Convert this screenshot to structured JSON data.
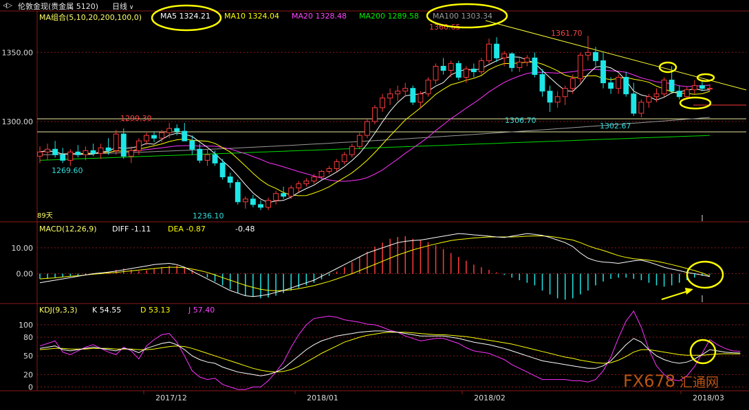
{
  "header": {
    "back_glyph": "◃▷",
    "instrument": "伦敦金现(贵金属 5120)",
    "period": "日线"
  },
  "colors": {
    "up": "#ff3b3b",
    "down": "#1ee6e6",
    "ma5": "#ffffff",
    "ma10": "#ffff00",
    "ma20": "#ff33ff",
    "ma200": "#00dd00",
    "ma100": "#9a9a9a",
    "diff": "#ffffff",
    "dea": "#ffff00",
    "k": "#ffffff",
    "d": "#ffff00",
    "j": "#ff33ff",
    "annotation": "#ffff00",
    "grid": "#8b1a1a"
  },
  "price_panel": {
    "legend": {
      "title": "MA组合(5,10,20,200,100,0)",
      "ma5": "MA5 1324.21",
      "ma10": "MA10 1324.04",
      "ma20": "MA20 1328.48",
      "ma200": "MA200 1289.58",
      "ma100": "MA100 1303.34"
    },
    "y_ticks": [
      "1350.00",
      "1300.00"
    ],
    "ylim": [
      1228,
      1372
    ],
    "days_label": "89天",
    "annotations": [
      {
        "text": "1299.30",
        "color": "#ff4444"
      },
      {
        "text": "1269.60",
        "color": "#33dddd"
      },
      {
        "text": "1236.10",
        "color": "#33dddd"
      },
      {
        "text": "1360.65",
        "color": "#ff4444"
      },
      {
        "text": "1361.70",
        "color": "#ff4444"
      },
      {
        "text": "1306.70",
        "color": "#33dddd"
      },
      {
        "text": "1302.67",
        "color": "#33dddd"
      }
    ]
  },
  "macd_panel": {
    "legend": {
      "title": "MACD(12,26,9)",
      "diff": "DIFF  -1.11",
      "dea": "DEA  -0.87",
      "macd": "-0.48"
    },
    "y_ticks": [
      "10.00",
      "0.00"
    ],
    "ylim": [
      -11,
      15
    ]
  },
  "kdj_panel": {
    "legend": {
      "title": "KDJ(9,3,3)",
      "k": "K  54.55",
      "d": "D  53.13",
      "j": "J  57.40"
    },
    "y_ticks": [
      "100",
      "80",
      "50",
      "20",
      "0"
    ],
    "ylim": [
      -5,
      112
    ]
  },
  "x_axis": {
    "labels": [
      "2017/12",
      "2018/01",
      "2018/02",
      "2018/03"
    ]
  },
  "watermark": {
    "text": "FX678",
    "text2": "汇通网"
  },
  "chart_data": {
    "type": "candlestick",
    "series_count": 89,
    "candles": [
      {
        "o": 1275,
        "h": 1282,
        "l": 1270,
        "c": 1278
      },
      {
        "o": 1278,
        "h": 1284,
        "l": 1272,
        "c": 1280
      },
      {
        "o": 1280,
        "h": 1286,
        "l": 1274,
        "c": 1276
      },
      {
        "o": 1276,
        "h": 1281,
        "l": 1270,
        "c": 1272
      },
      {
        "o": 1272,
        "h": 1280,
        "l": 1268,
        "c": 1278
      },
      {
        "o": 1278,
        "h": 1283,
        "l": 1274,
        "c": 1276
      },
      {
        "o": 1276,
        "h": 1282,
        "l": 1272,
        "c": 1279
      },
      {
        "o": 1279,
        "h": 1284,
        "l": 1275,
        "c": 1277
      },
      {
        "o": 1277,
        "h": 1284,
        "l": 1273,
        "c": 1281
      },
      {
        "o": 1281,
        "h": 1288,
        "l": 1276,
        "c": 1279
      },
      {
        "o": 1279,
        "h": 1294,
        "l": 1276,
        "c": 1291
      },
      {
        "o": 1291,
        "h": 1295,
        "l": 1273,
        "c": 1275
      },
      {
        "o": 1275,
        "h": 1282,
        "l": 1270,
        "c": 1279
      },
      {
        "o": 1279,
        "h": 1288,
        "l": 1276,
        "c": 1286
      },
      {
        "o": 1286,
        "h": 1292,
        "l": 1283,
        "c": 1290
      },
      {
        "o": 1290,
        "h": 1293,
        "l": 1285,
        "c": 1288
      },
      {
        "o": 1288,
        "h": 1294,
        "l": 1285,
        "c": 1292
      },
      {
        "o": 1292,
        "h": 1299,
        "l": 1288,
        "c": 1295
      },
      {
        "o": 1295,
        "h": 1298,
        "l": 1290,
        "c": 1293
      },
      {
        "o": 1293,
        "h": 1299,
        "l": 1286,
        "c": 1286
      },
      {
        "o": 1286,
        "h": 1290,
        "l": 1276,
        "c": 1280
      },
      {
        "o": 1280,
        "h": 1284,
        "l": 1270,
        "c": 1272
      },
      {
        "o": 1272,
        "h": 1280,
        "l": 1268,
        "c": 1276
      },
      {
        "o": 1276,
        "h": 1279,
        "l": 1268,
        "c": 1270
      },
      {
        "o": 1270,
        "h": 1273,
        "l": 1258,
        "c": 1260
      },
      {
        "o": 1260,
        "h": 1263,
        "l": 1252,
        "c": 1256
      },
      {
        "o": 1256,
        "h": 1258,
        "l": 1240,
        "c": 1242
      },
      {
        "o": 1242,
        "h": 1246,
        "l": 1237,
        "c": 1244
      },
      {
        "o": 1244,
        "h": 1247,
        "l": 1238,
        "c": 1240
      },
      {
        "o": 1240,
        "h": 1243,
        "l": 1236,
        "c": 1238
      },
      {
        "o": 1238,
        "h": 1245,
        "l": 1236,
        "c": 1243
      },
      {
        "o": 1243,
        "h": 1250,
        "l": 1240,
        "c": 1248
      },
      {
        "o": 1248,
        "h": 1253,
        "l": 1244,
        "c": 1246
      },
      {
        "o": 1246,
        "h": 1254,
        "l": 1244,
        "c": 1252
      },
      {
        "o": 1252,
        "h": 1257,
        "l": 1249,
        "c": 1255
      },
      {
        "o": 1255,
        "h": 1259,
        "l": 1253,
        "c": 1257
      },
      {
        "o": 1257,
        "h": 1262,
        "l": 1255,
        "c": 1260
      },
      {
        "o": 1260,
        "h": 1265,
        "l": 1258,
        "c": 1264
      },
      {
        "o": 1264,
        "h": 1268,
        "l": 1262,
        "c": 1266
      },
      {
        "o": 1266,
        "h": 1273,
        "l": 1264,
        "c": 1271
      },
      {
        "o": 1271,
        "h": 1278,
        "l": 1269,
        "c": 1276
      },
      {
        "o": 1276,
        "h": 1284,
        "l": 1274,
        "c": 1282
      },
      {
        "o": 1282,
        "h": 1292,
        "l": 1280,
        "c": 1290
      },
      {
        "o": 1290,
        "h": 1302,
        "l": 1288,
        "c": 1300
      },
      {
        "o": 1300,
        "h": 1312,
        "l": 1298,
        "c": 1310
      },
      {
        "o": 1310,
        "h": 1320,
        "l": 1307,
        "c": 1317
      },
      {
        "o": 1317,
        "h": 1324,
        "l": 1312,
        "c": 1320
      },
      {
        "o": 1320,
        "h": 1326,
        "l": 1315,
        "c": 1322
      },
      {
        "o": 1322,
        "h": 1328,
        "l": 1318,
        "c": 1324
      },
      {
        "o": 1324,
        "h": 1326,
        "l": 1312,
        "c": 1314
      },
      {
        "o": 1314,
        "h": 1322,
        "l": 1310,
        "c": 1320
      },
      {
        "o": 1320,
        "h": 1332,
        "l": 1318,
        "c": 1330
      },
      {
        "o": 1330,
        "h": 1342,
        "l": 1327,
        "c": 1340
      },
      {
        "o": 1340,
        "h": 1346,
        "l": 1334,
        "c": 1337
      },
      {
        "o": 1337,
        "h": 1344,
        "l": 1332,
        "c": 1342
      },
      {
        "o": 1342,
        "h": 1344,
        "l": 1330,
        "c": 1332
      },
      {
        "o": 1332,
        "h": 1340,
        "l": 1328,
        "c": 1338
      },
      {
        "o": 1338,
        "h": 1342,
        "l": 1332,
        "c": 1336
      },
      {
        "o": 1336,
        "h": 1346,
        "l": 1334,
        "c": 1344
      },
      {
        "o": 1344,
        "h": 1360,
        "l": 1342,
        "c": 1356
      },
      {
        "o": 1356,
        "h": 1361,
        "l": 1343,
        "c": 1346
      },
      {
        "o": 1346,
        "h": 1351,
        "l": 1340,
        "c": 1349
      },
      {
        "o": 1349,
        "h": 1350,
        "l": 1336,
        "c": 1339
      },
      {
        "o": 1339,
        "h": 1346,
        "l": 1336,
        "c": 1343
      },
      {
        "o": 1343,
        "h": 1348,
        "l": 1340,
        "c": 1346
      },
      {
        "o": 1346,
        "h": 1350,
        "l": 1332,
        "c": 1334
      },
      {
        "o": 1334,
        "h": 1338,
        "l": 1318,
        "c": 1322
      },
      {
        "o": 1322,
        "h": 1326,
        "l": 1307,
        "c": 1314
      },
      {
        "o": 1314,
        "h": 1322,
        "l": 1310,
        "c": 1318
      },
      {
        "o": 1318,
        "h": 1326,
        "l": 1312,
        "c": 1324
      },
      {
        "o": 1324,
        "h": 1334,
        "l": 1320,
        "c": 1331
      },
      {
        "o": 1331,
        "h": 1350,
        "l": 1328,
        "c": 1348
      },
      {
        "o": 1348,
        "h": 1362,
        "l": 1344,
        "c": 1350
      },
      {
        "o": 1350,
        "h": 1354,
        "l": 1340,
        "c": 1344
      },
      {
        "o": 1344,
        "h": 1350,
        "l": 1324,
        "c": 1328
      },
      {
        "o": 1328,
        "h": 1332,
        "l": 1320,
        "c": 1324
      },
      {
        "o": 1324,
        "h": 1334,
        "l": 1320,
        "c": 1332
      },
      {
        "o": 1332,
        "h": 1336,
        "l": 1318,
        "c": 1320
      },
      {
        "o": 1320,
        "h": 1328,
        "l": 1304,
        "c": 1306
      },
      {
        "o": 1306,
        "h": 1316,
        "l": 1303,
        "c": 1314
      },
      {
        "o": 1314,
        "h": 1320,
        "l": 1310,
        "c": 1318
      },
      {
        "o": 1318,
        "h": 1324,
        "l": 1314,
        "c": 1320
      },
      {
        "o": 1320,
        "h": 1332,
        "l": 1318,
        "c": 1330
      },
      {
        "o": 1330,
        "h": 1340,
        "l": 1320,
        "c": 1322
      },
      {
        "o": 1322,
        "h": 1326,
        "l": 1316,
        "c": 1318
      },
      {
        "o": 1318,
        "h": 1325,
        "l": 1316,
        "c": 1323
      },
      {
        "o": 1323,
        "h": 1330,
        "l": 1320,
        "c": 1326
      },
      {
        "o": 1326,
        "h": 1329,
        "l": 1322,
        "c": 1324
      },
      {
        "o": 1324,
        "h": 1327,
        "l": 1322,
        "c": 1324
      }
    ],
    "macd_bars": [
      -2,
      -2,
      -1.5,
      -1.2,
      -1,
      -0.8,
      -0.5,
      -0.2,
      0.3,
      0.8,
      1.5,
      2,
      1.5,
      1,
      1.3,
      2,
      2.5,
      3,
      3.2,
      2.5,
      1.5,
      0,
      -1.5,
      -3,
      -4.5,
      -6,
      -7.5,
      -8.5,
      -9,
      -9.5,
      -9.2,
      -8.5,
      -7.5,
      -6.5,
      -5.5,
      -4.5,
      -3.5,
      -2.2,
      -0.8,
      0.8,
      2.5,
      4.5,
      6.5,
      8.5,
      10.5,
      12,
      13.5,
      14.2,
      14.5,
      13.5,
      13,
      12.2,
      11,
      9.5,
      8,
      6.5,
      5,
      3.5,
      2.5,
      1.5,
      0.5,
      -0.5,
      -1.5,
      -2.5,
      -3.5,
      -4.5,
      -6.5,
      -8,
      -9.5,
      -10,
      -9.5,
      -8,
      -6.5,
      -4.5,
      -3,
      -2,
      -1.5,
      -1.5,
      -2,
      -2.5,
      -3.5,
      -4.5,
      -5,
      -4.5,
      -3.5,
      -2.5,
      -1.5,
      -0.8,
      -0.48
    ],
    "diff": [
      -3.5,
      -3,
      -2.5,
      -2,
      -1.5,
      -1,
      -0.5,
      0,
      0.3,
      0.6,
      1,
      1.5,
      2,
      2.5,
      3,
      3.5,
      3.8,
      4,
      3.5,
      2.5,
      1,
      -0.5,
      -2,
      -3.5,
      -5,
      -6.5,
      -7.5,
      -8.5,
      -8.8,
      -8.5,
      -8,
      -7.2,
      -6.5,
      -5.5,
      -4.5,
      -3.5,
      -2.5,
      -1,
      0.5,
      2,
      3.5,
      5,
      6.5,
      8,
      9,
      10,
      11,
      12,
      12.5,
      12.8,
      13,
      13.5,
      14,
      14.5,
      15,
      15.5,
      15.3,
      15,
      14.8,
      14.5,
      14.2,
      14,
      14.5,
      15,
      15.5,
      15.2,
      14.8,
      14,
      13,
      12,
      10.5,
      8,
      6,
      5,
      4.5,
      4.3,
      4,
      4.5,
      5,
      5.2,
      4.5,
      3.5,
      2.5,
      1.8,
      1.2,
      0.5,
      0,
      -0.5,
      -1.11
    ],
    "dea": [
      -2,
      -1.8,
      -1.6,
      -1.3,
      -1,
      -0.8,
      -0.5,
      -0.2,
      0,
      0.3,
      0.5,
      0.8,
      1.1,
      1.4,
      1.7,
      2,
      2.3,
      2.5,
      2.5,
      2.3,
      1.8,
      1.2,
      0.5,
      -0.5,
      -1.5,
      -2.5,
      -3.5,
      -4.5,
      -5.3,
      -6,
      -6.4,
      -6.6,
      -6.5,
      -6.2,
      -5.8,
      -5.2,
      -4.6,
      -3.8,
      -3,
      -2,
      -1,
      0,
      1.2,
      2.4,
      3.6,
      4.8,
      6,
      7.2,
      8.2,
      9.2,
      10,
      10.8,
      11.5,
      12.2,
      12.8,
      13.2,
      13.5,
      13.8,
      14,
      14.2,
      14.2,
      14.2,
      14.2,
      14.3,
      14.5,
      14.6,
      14.6,
      14.4,
      14,
      13.5,
      13,
      12,
      10.8,
      9.8,
      9,
      8,
      7,
      6.3,
      5.8,
      5.5,
      5.2,
      4.8,
      4.2,
      3.5,
      2.8,
      2,
      1.2,
      0.3,
      -0.87
    ],
    "k": [
      62,
      64,
      66,
      60,
      58,
      60,
      62,
      64,
      62,
      60,
      58,
      62,
      60,
      55,
      62,
      66,
      70,
      72,
      68,
      60,
      50,
      44,
      40,
      38,
      32,
      28,
      24,
      22,
      20,
      18,
      20,
      24,
      30,
      40,
      50,
      60,
      68,
      74,
      78,
      82,
      84,
      86,
      88,
      89,
      90,
      90,
      89,
      88,
      86,
      84,
      82,
      82,
      82,
      82,
      80,
      78,
      75,
      72,
      70,
      68,
      65,
      62,
      58,
      54,
      50,
      46,
      42,
      40,
      38,
      36,
      34,
      32,
      30,
      30,
      34,
      42,
      55,
      68,
      78,
      72,
      60,
      50,
      44,
      40,
      38,
      40,
      45,
      52,
      60,
      58,
      56,
      55,
      54.55
    ],
    "d": [
      60,
      61,
      62,
      62,
      61,
      61,
      61,
      62,
      62,
      62,
      61,
      61,
      61,
      60,
      60,
      61,
      63,
      65,
      66,
      65,
      62,
      58,
      54,
      50,
      46,
      42,
      38,
      34,
      30,
      27,
      25,
      24,
      25,
      28,
      33,
      40,
      47,
      54,
      60,
      66,
      72,
      76,
      80,
      83,
      85,
      87,
      88,
      88,
      88,
      87,
      86,
      85,
      84,
      84,
      83,
      82,
      81,
      79,
      77,
      75,
      73,
      71,
      69,
      66,
      63,
      60,
      57,
      54,
      51,
      48,
      46,
      43,
      41,
      39,
      38,
      39,
      43,
      49,
      56,
      60,
      60,
      58,
      56,
      54,
      52,
      51,
      51,
      51,
      52,
      53,
      53.5,
      53.3,
      53.13
    ],
    "j": [
      66,
      70,
      74,
      56,
      52,
      58,
      64,
      68,
      62,
      56,
      52,
      64,
      58,
      45,
      66,
      76,
      84,
      86,
      72,
      50,
      26,
      16,
      12,
      14,
      4,
      0,
      -4,
      -4,
      0,
      0,
      10,
      24,
      40,
      64,
      84,
      100,
      110,
      112,
      114,
      112,
      108,
      106,
      104,
      101,
      100,
      96,
      91,
      88,
      82,
      78,
      74,
      76,
      78,
      78,
      74,
      70,
      63,
      58,
      56,
      54,
      49,
      44,
      36,
      30,
      24,
      18,
      12,
      12,
      12,
      12,
      10,
      10,
      8,
      12,
      26,
      48,
      79,
      106,
      122,
      96,
      60,
      34,
      20,
      12,
      10,
      18,
      33,
      54,
      76,
      68,
      62,
      58,
      57.4
    ]
  }
}
